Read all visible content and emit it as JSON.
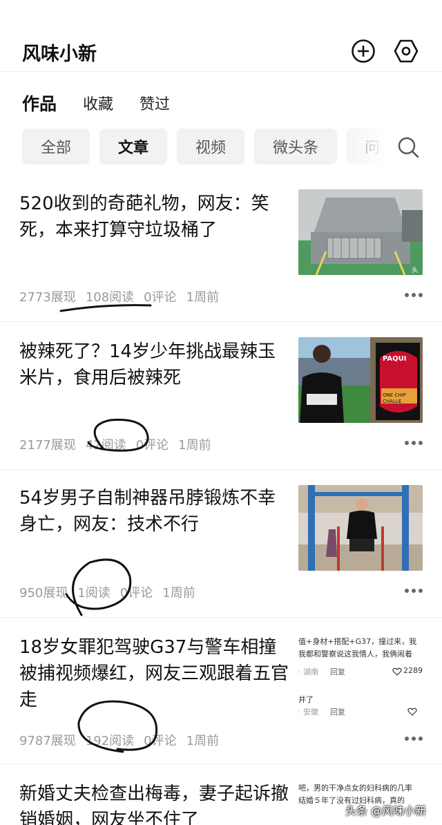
{
  "header": {
    "title": "风味小新"
  },
  "tabs": [
    {
      "label": "作品"
    },
    {
      "label": "收藏"
    },
    {
      "label": "赞过"
    }
  ],
  "chips": [
    {
      "label": "全部"
    },
    {
      "label": "文章"
    },
    {
      "label": "视频"
    },
    {
      "label": "微头条"
    },
    {
      "label": "问"
    }
  ],
  "articles": [
    {
      "title": "520收到的奇葩礼物，网友：笑死，本来打算守垃圾桶了",
      "views": "2773展现",
      "reads": "108阅读",
      "comments": "0评论",
      "time": "1周前",
      "thumb_caption": "头条"
    },
    {
      "title": "被辣死了？14岁少年挑战最辣玉米片，食用后被辣死",
      "views": "2177展现",
      "reads": "42阅读",
      "comments": "0评论",
      "time": "1周前",
      "thumb_sign_top": "PAQUI",
      "thumb_sign_bottom": "ONE CHIP CHALLE"
    },
    {
      "title": "54岁男子自制神器吊脖锻炼不幸身亡，网友：技术不行",
      "views": "950展现",
      "reads": "1阅读",
      "comments": "0评论",
      "time": "1周前"
    },
    {
      "title": "18岁女罪犯驾驶G37与警车相撞被捕视频爆红，网友三观跟着五官走",
      "views": "9787展现",
      "reads": "192阅读",
      "comments": "0评论",
      "time": "1周前",
      "thumb_lines": [
        "值+身材+搭配+G37，撞过来，我",
        "我都和警察说这我情人，我俩闹着"
      ],
      "thumb_loc1": "· 湖南",
      "thumb_reply": "回复",
      "thumb_likes": "2289",
      "thumb_line3": "并了",
      "thumb_loc2": "· 安徽"
    },
    {
      "title": "新婚丈夫检查出梅毒，妻子起诉撤销婚姻，网友坐不住了",
      "views": "",
      "reads": "",
      "comments": "",
      "time": "",
      "thumb_lines": [
        "吧，男的干净点女的妇科病的几率",
        "结婚５年了没有过妇科病，真的"
      ]
    }
  ],
  "watermark": "头条 @风味小新"
}
